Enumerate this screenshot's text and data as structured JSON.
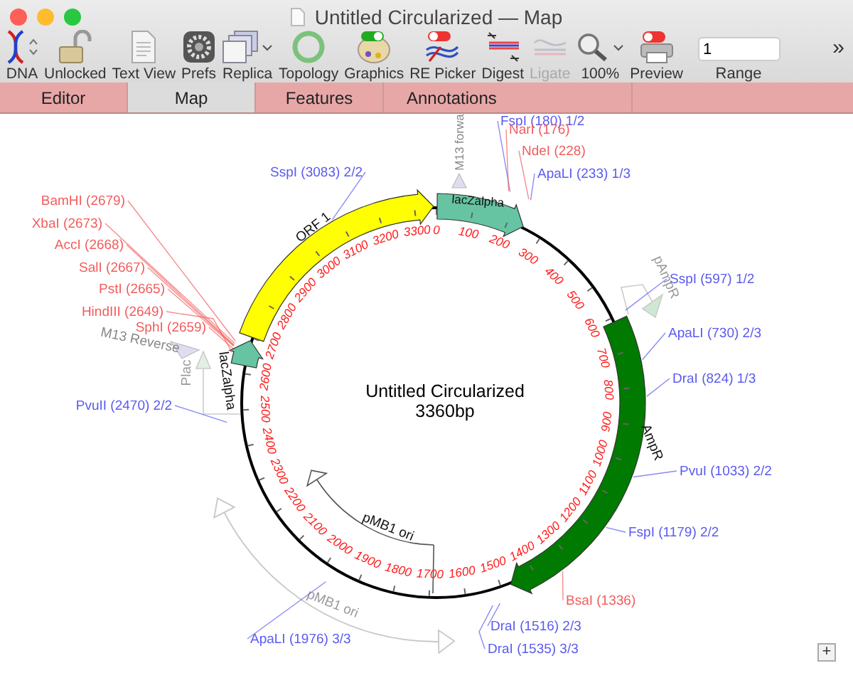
{
  "window": {
    "title": "Untitled Circularized — Map"
  },
  "toolbar": {
    "items": [
      {
        "label": "DNA",
        "disabled": false
      },
      {
        "label": "Unlocked",
        "disabled": false
      },
      {
        "label": "Text View",
        "disabled": false
      },
      {
        "label": "Prefs",
        "disabled": false
      },
      {
        "label": "Replica",
        "disabled": false
      },
      {
        "label": "Topology",
        "disabled": false
      },
      {
        "label": "Graphics",
        "disabled": false
      },
      {
        "label": "RE Picker",
        "disabled": false
      },
      {
        "label": "Digest",
        "disabled": false
      },
      {
        "label": "Ligate",
        "disabled": true
      },
      {
        "label": "100%",
        "disabled": false
      },
      {
        "label": "Preview",
        "disabled": false
      }
    ],
    "range": {
      "value": "1",
      "label": "Range"
    },
    "overflow": "»"
  },
  "tabs": [
    {
      "label": "Editor",
      "selected": false
    },
    {
      "label": "Map",
      "selected": true
    },
    {
      "label": "Features",
      "selected": false
    },
    {
      "label": "Annotations",
      "selected": false
    }
  ],
  "map": {
    "name": "Untitled Circularized",
    "length": "3360bp",
    "ticks": [
      "0",
      "100",
      "200",
      "300",
      "400",
      "500",
      "600",
      "700",
      "800",
      "900",
      "1000",
      "1100",
      "1200",
      "1300",
      "1400",
      "1500",
      "1600",
      "1700",
      "1800",
      "1900",
      "2000",
      "2100",
      "2200",
      "2300",
      "2400",
      "2500",
      "2600",
      "2700",
      "2800",
      "2900",
      "3000",
      "3100",
      "3200",
      "3300"
    ],
    "features": [
      {
        "label": "ORF 1",
        "kind": "band",
        "color": "#ffff00"
      },
      {
        "label": "lacZalpha",
        "kind": "band",
        "color": "#66c4a2"
      },
      {
        "label": "lacZalpha",
        "kind": "band",
        "color": "#66c4a2"
      },
      {
        "label": "AmpR",
        "kind": "band",
        "color": "#007a00"
      },
      {
        "label": "pMB1 ori",
        "kind": "line"
      },
      {
        "label": "pMB1 ori",
        "kind": "faint"
      },
      {
        "label": "M13 Reverse",
        "kind": "primer"
      },
      {
        "label": "Plac",
        "kind": "promoter"
      },
      {
        "label": "pAmpR",
        "kind": "promoter"
      },
      {
        "label": "M13 forwa",
        "kind": "primer"
      }
    ],
    "sites": [
      {
        "label": "FspI (180) 1/2",
        "color": "#5a5af0"
      },
      {
        "label": "NarI (176)",
        "color": "#f25c5c"
      },
      {
        "label": "NdeI (228)",
        "color": "#f25c5c"
      },
      {
        "label": "SspI (3083) 2/2",
        "color": "#5a5af0"
      },
      {
        "label": "ApaLI (233) 1/3",
        "color": "#5a5af0"
      },
      {
        "label": "BamHI (2679)",
        "color": "#f25c5c"
      },
      {
        "label": "XbaI (2673)",
        "color": "#f25c5c"
      },
      {
        "label": "AccI (2668)",
        "color": "#f25c5c"
      },
      {
        "label": "SalI (2667)",
        "color": "#f25c5c"
      },
      {
        "label": "PstI (2665)",
        "color": "#f25c5c"
      },
      {
        "label": "SspI (597) 1/2",
        "color": "#5a5af0"
      },
      {
        "label": "HindIII (2649)",
        "color": "#f25c5c"
      },
      {
        "label": "SphI (2659)",
        "color": "#f25c5c"
      },
      {
        "label": "ApaLI (730) 2/3",
        "color": "#5a5af0"
      },
      {
        "label": "DraI (824) 1/3",
        "color": "#5a5af0"
      },
      {
        "label": "PvuII (2470) 2/2",
        "color": "#5a5af0"
      },
      {
        "label": "PvuI (1033) 2/2",
        "color": "#5a5af0"
      },
      {
        "label": "FspI (1179) 2/2",
        "color": "#5a5af0"
      },
      {
        "label": "BsaI (1336)",
        "color": "#f25c5c"
      },
      {
        "label": "DraI (1516) 2/3",
        "color": "#5a5af0"
      },
      {
        "label": "DraI (1535) 3/3",
        "color": "#5a5af0"
      },
      {
        "label": "ApaLI (1976) 3/3",
        "color": "#5a5af0"
      }
    ]
  },
  "zoom_button": "+"
}
